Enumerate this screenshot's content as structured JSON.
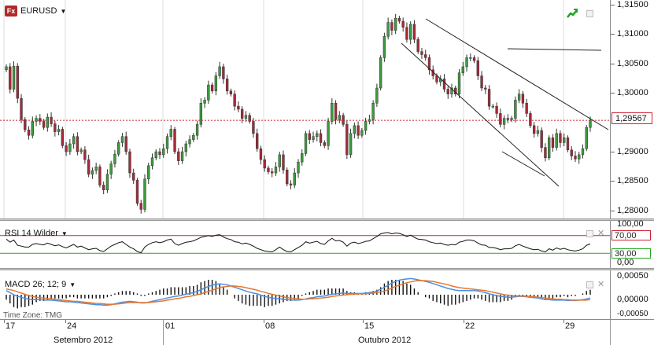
{
  "symbol": {
    "logo": "Fx",
    "name": "EURUSD"
  },
  "price_axis": {
    "ticks": [
      "1,31500",
      "1,31000",
      "1,30500",
      "1,30000",
      "1,29500",
      "1,29000",
      "1,28500",
      "1,28000"
    ],
    "current_price": "1,29567"
  },
  "rsi": {
    "label": "RSI 14 Wilder",
    "ticks": [
      "100,00",
      "70,00",
      "30,00",
      "0,00"
    ]
  },
  "macd": {
    "label": "MACD 26; 12; 9",
    "ticks": [
      "0,00050",
      "0,00000",
      "-0,00050"
    ]
  },
  "time_zone": "Time Zone: TMG",
  "x_axis": {
    "days": [
      "17",
      "24",
      "01",
      "08",
      "15",
      "22",
      "29"
    ],
    "months": [
      "Setembro 2012",
      "Outubro 2012"
    ]
  },
  "colors": {
    "up": "#3d9a3d",
    "down": "#a52a3a",
    "macd_blue": "#4a90e2",
    "macd_orange": "#e8772e"
  },
  "icons": {
    "trend": "trend-arrow-icon",
    "window": "window-icon",
    "close": "close-icon",
    "dropdown": "caret-down-icon"
  },
  "chart_data": {
    "type": "candlestick",
    "categories_note": "",
    "x_tick_labels": [
      "17",
      "24",
      "01",
      "08",
      "15",
      "22",
      "29"
    ],
    "close": [
      1.3045,
      1.3008,
      1.3046,
      1.2993,
      1.2958,
      1.2941,
      1.2932,
      1.2955,
      1.296,
      1.2955,
      1.2945,
      1.2962,
      1.2951,
      1.2938,
      1.2942,
      1.2915,
      1.2905,
      1.2918,
      1.293,
      1.2905,
      1.2908,
      1.2892,
      1.2868,
      1.2874,
      1.288,
      1.285,
      1.2842,
      1.2868,
      1.2885,
      1.2901,
      1.292,
      1.293,
      1.2905,
      1.287,
      1.2858,
      1.282,
      1.281,
      1.286,
      1.2882,
      1.2895,
      1.2905,
      1.29,
      1.291,
      1.293,
      1.2942,
      1.2905,
      1.289,
      1.2905,
      1.2918,
      1.2925,
      1.2932,
      1.295,
      1.2985,
      1.299,
      1.3015,
      1.3005,
      1.303,
      1.3045,
      1.3025,
      1.3005,
      1.3,
      1.298,
      1.2975,
      1.296,
      1.2965,
      1.2955,
      1.2935,
      1.291,
      1.2892,
      1.2878,
      1.2872,
      1.287,
      1.288,
      1.29,
      1.2875,
      1.2852,
      1.285,
      1.287,
      1.2888,
      1.2902,
      1.2935,
      1.2925,
      1.293,
      1.2935,
      1.292,
      1.2915,
      1.2955,
      1.2985,
      1.2958,
      1.2965,
      1.295,
      1.29,
      1.2935,
      1.2948,
      1.2932,
      1.294,
      1.2955,
      1.2958,
      1.2985,
      1.301,
      1.306,
      1.3095,
      1.3118,
      1.3105,
      1.3125,
      1.312,
      1.311,
      1.309,
      1.3115,
      1.309,
      1.307,
      1.3065,
      1.306,
      1.304,
      1.303,
      1.302,
      1.3025,
      1.3008,
      1.3,
      1.301,
      1.3,
      1.3035,
      1.3045,
      1.306,
      1.306,
      1.3055,
      1.303,
      1.301,
      1.3008,
      1.298,
      1.298,
      1.2968,
      1.295,
      1.296,
      1.2958,
      1.296,
      1.299,
      1.3,
      1.2985,
      1.2968,
      1.2948,
      1.2935,
      1.294,
      1.2912,
      1.2895,
      1.2928,
      1.2912,
      1.2935,
      1.292,
      1.2928,
      1.2908,
      1.2898,
      1.2893,
      1.29,
      1.291,
      1.2945,
      1.2957
    ],
    "ylim": [
      1.2795,
      1.3155
    ],
    "rsi_values": [
      62,
      55,
      60,
      48,
      46,
      44,
      44,
      50,
      52,
      50,
      49,
      53,
      50,
      47,
      49,
      45,
      42,
      46,
      50,
      44,
      46,
      42,
      38,
      40,
      41,
      36,
      34,
      40,
      46,
      50,
      54,
      56,
      50,
      44,
      40,
      34,
      31,
      44,
      50,
      54,
      56,
      54,
      56,
      60,
      62,
      52,
      48,
      52,
      55,
      56,
      58,
      62,
      66,
      68,
      70,
      68,
      71,
      72,
      67,
      63,
      61,
      56,
      55,
      51,
      53,
      50,
      46,
      41,
      38,
      35,
      34,
      33,
      38,
      44,
      38,
      34,
      33,
      38,
      43,
      48,
      56,
      53,
      55,
      57,
      52,
      50,
      58,
      64,
      58,
      59,
      55,
      46,
      53,
      55,
      52,
      54,
      57,
      58,
      63,
      68,
      74,
      76,
      77,
      74,
      76,
      75,
      72,
      68,
      71,
      66,
      62,
      61,
      60,
      56,
      54,
      52,
      53,
      50,
      48,
      50,
      49,
      55,
      57,
      60,
      60,
      58,
      53,
      49,
      48,
      43,
      43,
      41,
      38,
      40,
      40,
      41,
      47,
      50,
      46,
      43,
      40,
      38,
      39,
      35,
      33,
      40,
      37,
      42,
      39,
      41,
      38,
      36,
      35,
      37,
      40,
      48,
      51
    ],
    "macd_line": [
      0.0001,
      5e-05,
      0.0,
      -4e-05,
      -6e-05,
      -9e-05,
      -0.00011,
      -0.00012,
      -0.00012,
      -0.00012,
      -0.00013,
      -0.00013,
      -0.00013,
      -0.00014,
      -0.00015,
      -0.00016,
      -0.00017,
      -0.00017,
      -0.00018,
      -0.00019,
      -0.0002,
      -0.00021,
      -0.00022,
      -0.00023,
      -0.00024,
      -0.00024,
      -0.00025,
      -0.00025,
      -0.00024,
      -0.00022,
      -0.0002,
      -0.00018,
      -0.00017,
      -0.00016,
      -0.00017,
      -0.00018,
      -0.0002,
      -0.0002,
      -0.00018,
      -0.00016,
      -0.00014,
      -0.00012,
      -0.0001,
      -8e-05,
      -6e-05,
      -4e-05,
      -3e-05,
      -1e-05,
      1e-05,
      3e-05,
      5e-05,
      8e-05,
      0.00012,
      0.00016,
      0.0002,
      0.00023,
      0.00025,
      0.00026,
      0.00025,
      0.00024,
      0.00021,
      0.00018,
      0.00015,
      0.00012,
      9e-05,
      6e-05,
      4e-05,
      2e-05,
      -1e-05,
      -4e-05,
      -6e-05,
      -8e-05,
      -9e-05,
      -0.0001,
      -0.00011,
      -0.00012,
      -0.00013,
      -0.00013,
      -0.00013,
      -0.00012,
      -0.0001,
      -8e-05,
      -7e-05,
      -5e-05,
      -4e-05,
      -3e-05,
      -1e-05,
      1e-05,
      2e-05,
      3e-05,
      4e-05,
      3e-05,
      3e-05,
      3e-05,
      3e-05,
      3e-05,
      4e-05,
      5e-05,
      7e-05,
      9e-05,
      0.00013,
      0.00018,
      0.00023,
      0.00028,
      0.00032,
      0.00035,
      0.00037,
      0.00038,
      0.00039,
      0.00038,
      0.00036,
      0.00034,
      0.00032,
      0.0003,
      0.00027,
      0.00024,
      0.00021,
      0.00018,
      0.00015,
      0.00013,
      0.00011,
      0.0001,
      0.0001,
      0.0001,
      0.0001,
      0.0001,
      9e-05,
      7e-05,
      5e-05,
      2e-05,
      0.0,
      -2e-05,
      -4e-05,
      -5e-05,
      -6e-05,
      -6e-05,
      -5e-05,
      -4e-05,
      -4e-05,
      -5e-05,
      -6e-05,
      -7e-05,
      -8e-05,
      -0.0001,
      -0.00012,
      -0.00012,
      -0.00013,
      -0.00013,
      -0.00013,
      -0.00013,
      -0.00014,
      -0.00014,
      -0.00014,
      -0.00013,
      -0.00012,
      -0.0001,
      -8e-05
    ],
    "macd_signal": [
      0.00014,
      0.00012,
      0.0001,
      7e-05,
      4e-05,
      1e-05,
      -2e-05,
      -4e-05,
      -6e-05,
      -7e-05,
      -8e-05,
      -9e-05,
      -0.0001,
      -0.00011,
      -0.00012,
      -0.00013,
      -0.00014,
      -0.00015,
      -0.00016,
      -0.00016,
      -0.00017,
      -0.00018,
      -0.00019,
      -0.0002,
      -0.00021,
      -0.00021,
      -0.00022,
      -0.00023,
      -0.00023,
      -0.00023,
      -0.00022,
      -0.00021,
      -0.0002,
      -0.00019,
      -0.00019,
      -0.00019,
      -0.00019,
      -0.00019,
      -0.00019,
      -0.00018,
      -0.00017,
      -0.00016,
      -0.00015,
      -0.00013,
      -0.00012,
      -0.0001,
      -9e-05,
      -7e-05,
      -5e-05,
      -4e-05,
      -2e-05,
      0.0,
      2e-05,
      5e-05,
      8e-05,
      0.00011,
      0.00014,
      0.00017,
      0.00019,
      0.0002,
      0.00021,
      0.00021,
      0.0002,
      0.00019,
      0.00017,
      0.00015,
      0.00013,
      0.00011,
      8e-05,
      6e-05,
      3e-05,
      1e-05,
      -1e-05,
      -3e-05,
      -5e-05,
      -7e-05,
      -8e-05,
      -9e-05,
      -0.0001,
      -0.00011,
      -0.00011,
      -0.0001,
      -0.0001,
      -9e-05,
      -8e-05,
      -7e-05,
      -6e-05,
      -4e-05,
      -3e-05,
      -2e-05,
      -1e-05,
      0.0,
      1e-05,
      1e-05,
      2e-05,
      2e-05,
      2e-05,
      3e-05,
      4e-05,
      5e-05,
      7e-05,
      9e-05,
      0.00012,
      0.00016,
      0.0002,
      0.00023,
      0.00026,
      0.00029,
      0.00031,
      0.00033,
      0.00034,
      0.00034,
      0.00034,
      0.00033,
      0.00032,
      0.0003,
      0.00028,
      0.00026,
      0.00024,
      0.00021,
      0.00019,
      0.00017,
      0.00016,
      0.00015,
      0.00014,
      0.00013,
      0.00012,
      0.00011,
      0.0001,
      8e-05,
      6e-05,
      4e-05,
      2e-05,
      0.0,
      -1e-05,
      -2e-05,
      -3e-05,
      -3e-05,
      -3e-05,
      -4e-05,
      -4e-05,
      -5e-05,
      -6e-05,
      -7e-05,
      -8e-05,
      -9e-05,
      -0.0001,
      -0.00011,
      -0.00011,
      -0.00012,
      -0.00012,
      -0.00013,
      -0.00013,
      -0.00013,
      -0.00013,
      -0.00013,
      -0.00012
    ],
    "macd_ylim": [
      -0.00055,
      0.00055
    ],
    "rsi_ylim": [
      0,
      100
    ],
    "rsi_levels": [
      30,
      70
    ],
    "price_level": 1.29567
  }
}
